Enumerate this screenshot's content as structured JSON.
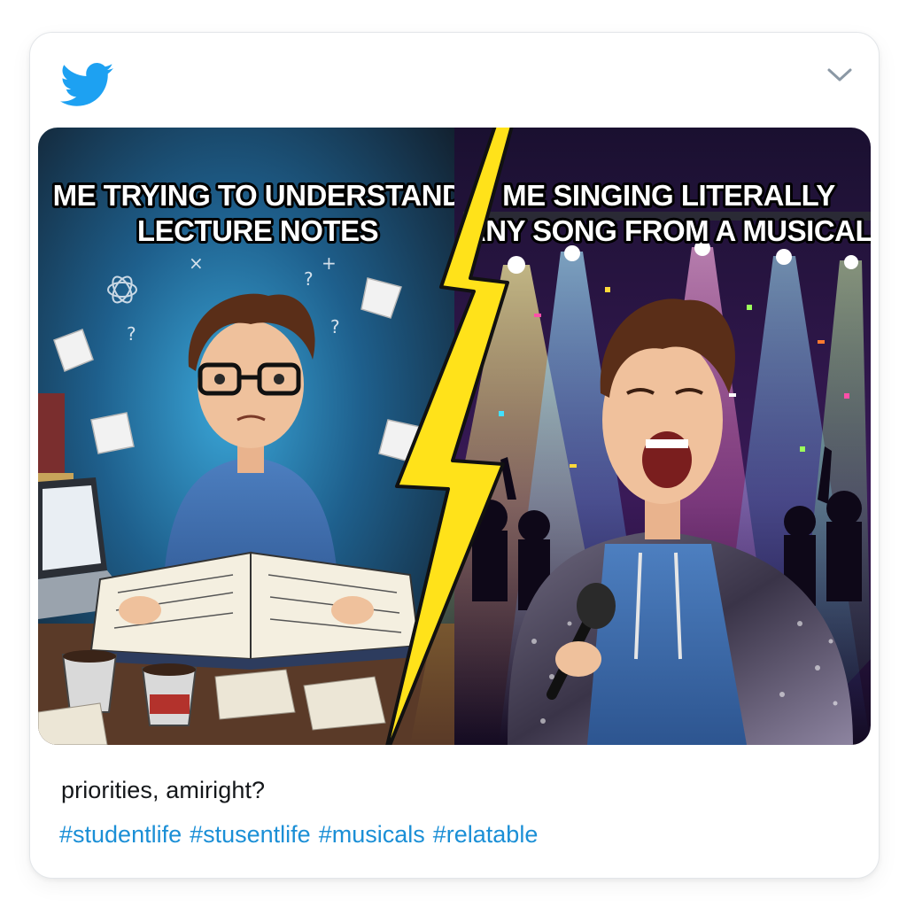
{
  "post": {
    "brand_color": "#1da1f2",
    "icons": {
      "logo": "twitter-bird-icon",
      "menu": "chevron-down-icon"
    },
    "meme": {
      "left_panel": {
        "caption_line1": "ME TRYING TO UNDERSTAND",
        "caption_line2": "LECTURE NOTES"
      },
      "right_panel": {
        "caption_line1": "ME SINGING LITERALLY",
        "caption_line2": "ANY SONG FROM A MUSICAL"
      },
      "divider": "lightning-bolt"
    },
    "text": "priorities, amiright?",
    "hashtags": [
      "#studentlife",
      "#stusentlife",
      "#musicals",
      "#relatable"
    ],
    "hashtag_color": "#1b8fd6"
  }
}
